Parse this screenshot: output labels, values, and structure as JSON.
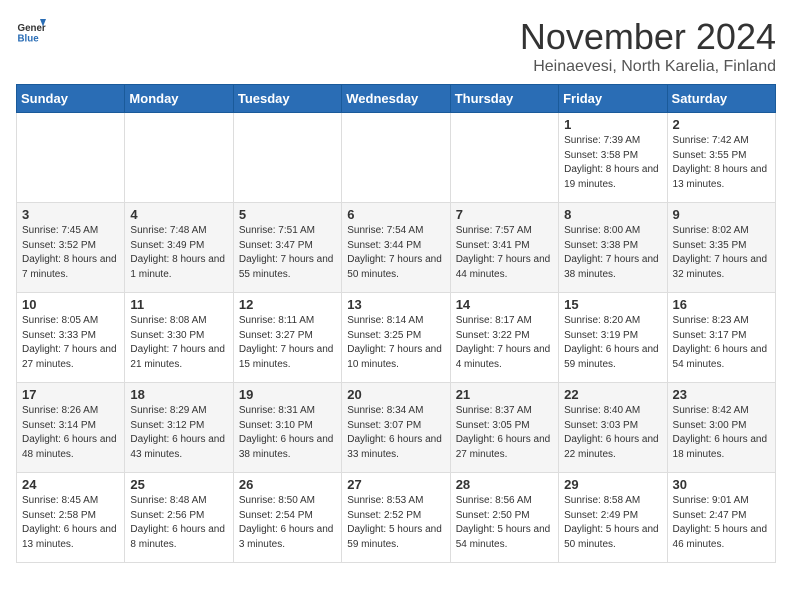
{
  "logo": {
    "general": "General",
    "blue": "Blue"
  },
  "title": "November 2024",
  "location": "Heinaevesi, North Karelia, Finland",
  "days_header": [
    "Sunday",
    "Monday",
    "Tuesday",
    "Wednesday",
    "Thursday",
    "Friday",
    "Saturday"
  ],
  "weeks": [
    [
      {
        "day": "",
        "info": ""
      },
      {
        "day": "",
        "info": ""
      },
      {
        "day": "",
        "info": ""
      },
      {
        "day": "",
        "info": ""
      },
      {
        "day": "",
        "info": ""
      },
      {
        "day": "1",
        "info": "Sunrise: 7:39 AM\nSunset: 3:58 PM\nDaylight: 8 hours and 19 minutes."
      },
      {
        "day": "2",
        "info": "Sunrise: 7:42 AM\nSunset: 3:55 PM\nDaylight: 8 hours and 13 minutes."
      }
    ],
    [
      {
        "day": "3",
        "info": "Sunrise: 7:45 AM\nSunset: 3:52 PM\nDaylight: 8 hours and 7 minutes."
      },
      {
        "day": "4",
        "info": "Sunrise: 7:48 AM\nSunset: 3:49 PM\nDaylight: 8 hours and 1 minute."
      },
      {
        "day": "5",
        "info": "Sunrise: 7:51 AM\nSunset: 3:47 PM\nDaylight: 7 hours and 55 minutes."
      },
      {
        "day": "6",
        "info": "Sunrise: 7:54 AM\nSunset: 3:44 PM\nDaylight: 7 hours and 50 minutes."
      },
      {
        "day": "7",
        "info": "Sunrise: 7:57 AM\nSunset: 3:41 PM\nDaylight: 7 hours and 44 minutes."
      },
      {
        "day": "8",
        "info": "Sunrise: 8:00 AM\nSunset: 3:38 PM\nDaylight: 7 hours and 38 minutes."
      },
      {
        "day": "9",
        "info": "Sunrise: 8:02 AM\nSunset: 3:35 PM\nDaylight: 7 hours and 32 minutes."
      }
    ],
    [
      {
        "day": "10",
        "info": "Sunrise: 8:05 AM\nSunset: 3:33 PM\nDaylight: 7 hours and 27 minutes."
      },
      {
        "day": "11",
        "info": "Sunrise: 8:08 AM\nSunset: 3:30 PM\nDaylight: 7 hours and 21 minutes."
      },
      {
        "day": "12",
        "info": "Sunrise: 8:11 AM\nSunset: 3:27 PM\nDaylight: 7 hours and 15 minutes."
      },
      {
        "day": "13",
        "info": "Sunrise: 8:14 AM\nSunset: 3:25 PM\nDaylight: 7 hours and 10 minutes."
      },
      {
        "day": "14",
        "info": "Sunrise: 8:17 AM\nSunset: 3:22 PM\nDaylight: 7 hours and 4 minutes."
      },
      {
        "day": "15",
        "info": "Sunrise: 8:20 AM\nSunset: 3:19 PM\nDaylight: 6 hours and 59 minutes."
      },
      {
        "day": "16",
        "info": "Sunrise: 8:23 AM\nSunset: 3:17 PM\nDaylight: 6 hours and 54 minutes."
      }
    ],
    [
      {
        "day": "17",
        "info": "Sunrise: 8:26 AM\nSunset: 3:14 PM\nDaylight: 6 hours and 48 minutes."
      },
      {
        "day": "18",
        "info": "Sunrise: 8:29 AM\nSunset: 3:12 PM\nDaylight: 6 hours and 43 minutes."
      },
      {
        "day": "19",
        "info": "Sunrise: 8:31 AM\nSunset: 3:10 PM\nDaylight: 6 hours and 38 minutes."
      },
      {
        "day": "20",
        "info": "Sunrise: 8:34 AM\nSunset: 3:07 PM\nDaylight: 6 hours and 33 minutes."
      },
      {
        "day": "21",
        "info": "Sunrise: 8:37 AM\nSunset: 3:05 PM\nDaylight: 6 hours and 27 minutes."
      },
      {
        "day": "22",
        "info": "Sunrise: 8:40 AM\nSunset: 3:03 PM\nDaylight: 6 hours and 22 minutes."
      },
      {
        "day": "23",
        "info": "Sunrise: 8:42 AM\nSunset: 3:00 PM\nDaylight: 6 hours and 18 minutes."
      }
    ],
    [
      {
        "day": "24",
        "info": "Sunrise: 8:45 AM\nSunset: 2:58 PM\nDaylight: 6 hours and 13 minutes."
      },
      {
        "day": "25",
        "info": "Sunrise: 8:48 AM\nSunset: 2:56 PM\nDaylight: 6 hours and 8 minutes."
      },
      {
        "day": "26",
        "info": "Sunrise: 8:50 AM\nSunset: 2:54 PM\nDaylight: 6 hours and 3 minutes."
      },
      {
        "day": "27",
        "info": "Sunrise: 8:53 AM\nSunset: 2:52 PM\nDaylight: 5 hours and 59 minutes."
      },
      {
        "day": "28",
        "info": "Sunrise: 8:56 AM\nSunset: 2:50 PM\nDaylight: 5 hours and 54 minutes."
      },
      {
        "day": "29",
        "info": "Sunrise: 8:58 AM\nSunset: 2:49 PM\nDaylight: 5 hours and 50 minutes."
      },
      {
        "day": "30",
        "info": "Sunrise: 9:01 AM\nSunset: 2:47 PM\nDaylight: 5 hours and 46 minutes."
      }
    ]
  ]
}
